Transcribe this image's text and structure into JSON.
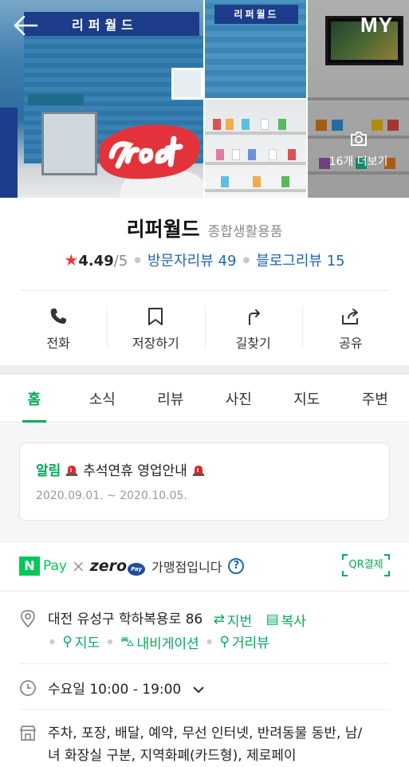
{
  "header": {
    "my_label": "MY"
  },
  "gallery": {
    "sign_main": "리퍼월드",
    "sign_small": "리퍼월드",
    "more_label": "16개 더보기"
  },
  "place": {
    "name": "리퍼월드",
    "category": "종합생활용품",
    "rating": "4.49",
    "rating_max": "/5",
    "visitor_reviews": "방문자리뷰 49",
    "blog_reviews": "블로그리뷰 15"
  },
  "actions": [
    {
      "label": "전화",
      "icon": "phone-icon"
    },
    {
      "label": "저장하기",
      "icon": "bookmark-icon"
    },
    {
      "label": "길찾기",
      "icon": "directions-icon"
    },
    {
      "label": "공유",
      "icon": "share-icon"
    }
  ],
  "tabs": [
    {
      "label": "홈",
      "active": true
    },
    {
      "label": "소식"
    },
    {
      "label": "리뷰"
    },
    {
      "label": "사진"
    },
    {
      "label": "지도"
    },
    {
      "label": "주변"
    }
  ],
  "notice": {
    "tag": "알림",
    "text": "추석연휴 영업안내",
    "date": "2020.09.01. ~ 2020.10.05."
  },
  "pay": {
    "npay": "Pay",
    "zero": "zero",
    "zero_pay": "Pay",
    "merchant": "가맹점입니다",
    "qr_label": "QR결제"
  },
  "address": {
    "road": "대전 유성구 학하복용로 86",
    "jibun": "지번",
    "copy": "복사",
    "map": "지도",
    "navigation": "내비게이션",
    "street_view": "거리뷰"
  },
  "hours": {
    "text": "수요일 10:00 - 19:00"
  },
  "amenities": {
    "line1": "주차, 포장, 배달, 예약, 무선 인터넷, 반려동물 동반, 남/",
    "line2": "녀 화장실 구분, 지역화폐(카드형), 제로페이"
  },
  "colors": {
    "accent_green": "#03aa5a",
    "review_blue": "#1f66b3",
    "star_red": "#ef3a3a"
  }
}
